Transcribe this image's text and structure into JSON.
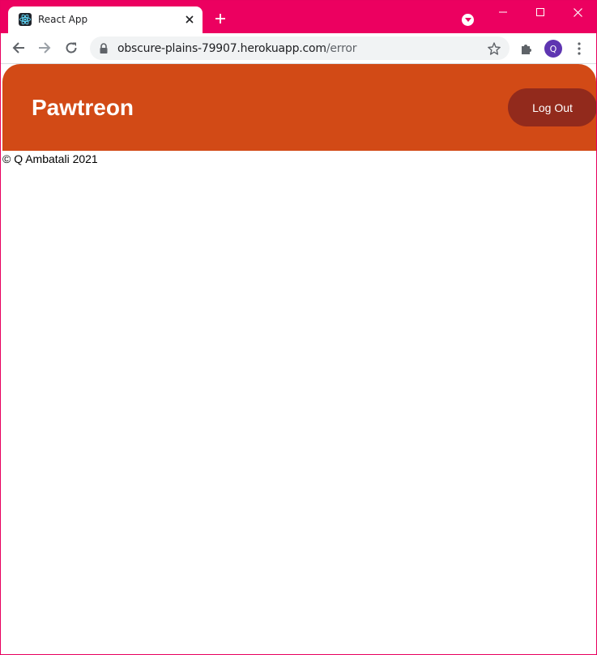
{
  "browser": {
    "tab_title": "React App",
    "url_domain": "obscure-plains-79907.herokuapp.com",
    "url_path": "/error",
    "profile_initial": "Q",
    "colors": {
      "titlebar": "#ec0060",
      "avatar": "#5e35b1"
    }
  },
  "app": {
    "brand": "Pawtreon",
    "logout_label": "Log Out",
    "footer_text": "© Q Ambatali 2021",
    "colors": {
      "header": "#d24a16",
      "logout_button": "#922a1c"
    }
  }
}
